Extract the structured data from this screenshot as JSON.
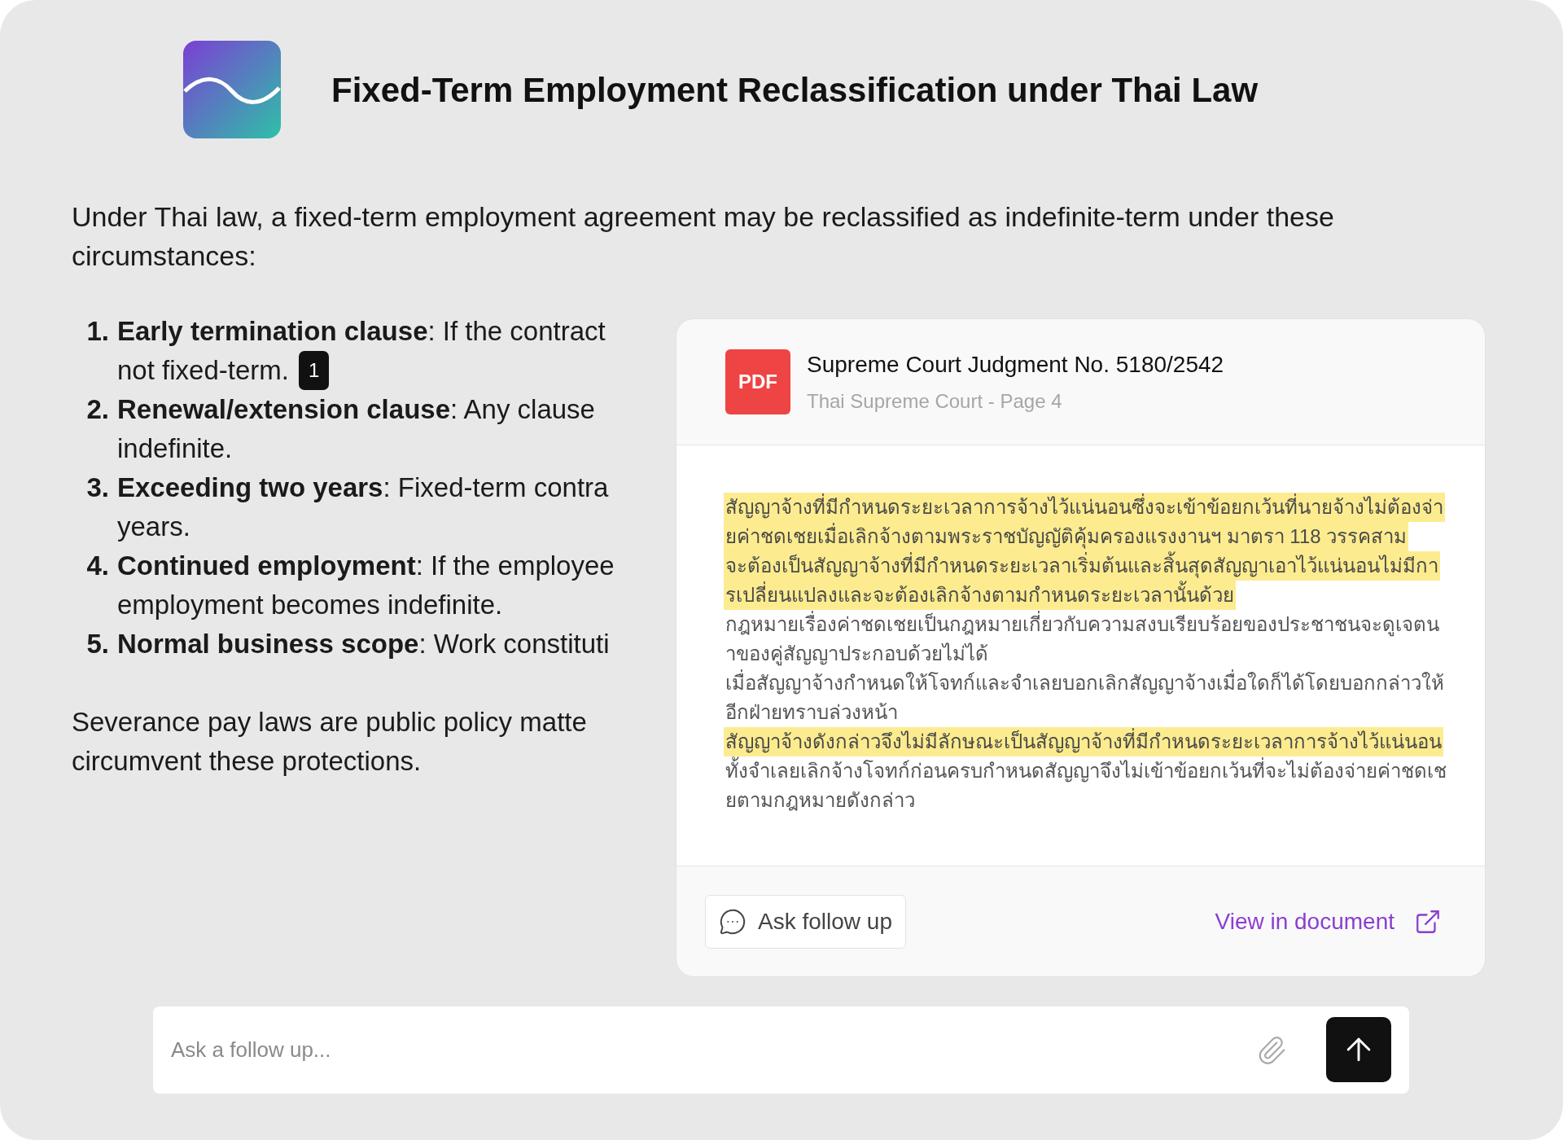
{
  "title": "Fixed-Term Employment Reclassification under Thai Law",
  "intro": "Under Thai law, a fixed-term employment agreement may be reclassified as indefinite-term under these circumstances:",
  "list": [
    {
      "number": "1.",
      "term": "Early termination clause",
      "rest": ": If the contract",
      "line2": "not fixed-term.",
      "citation": "1"
    },
    {
      "number": "2.",
      "term": "Renewal/extension clause",
      "rest": ": Any clause",
      "line2": "indefinite."
    },
    {
      "number": "3.",
      "term": "Exceeding two years",
      "rest": ": Fixed-term contra",
      "line2": "years."
    },
    {
      "number": "4.",
      "term": "Continued employment",
      "rest": ": If the employee",
      "line2": "employment becomes indefinite."
    },
    {
      "number": "5.",
      "term": "Normal business scope",
      "rest": ": Work constituti"
    }
  ],
  "closing": [
    "Severance pay laws are public policy matte",
    "circumvent these protections."
  ],
  "source_card": {
    "badge": "PDF",
    "title": "Supreme Court Judgment No. 5180/2542",
    "subtitle": "Thai Supreme Court - Page 4",
    "lines": [
      {
        "text": "สัญญาจ้างที่มีกำหนดระยะเวลาการจ้างไว้แน่นอนซึ่งจะเข้าข้อยกเว้นที่นายจ้างไม่ต้องจ่า",
        "highlighted": true
      },
      {
        "text": "ยค่าชดเชยเมื่อเลิกจ้างตามพระราชบัญญัติคุ้มครองแรงงานฯ มาตรา 118 วรรคสาม",
        "highlighted": true
      },
      {
        "text": "จะต้องเป็นสัญญาจ้างที่มีกำหนดระยะเวลาเริ่มต้นและสิ้นสุดสัญญาเอาไว้แน่นอนไม่มีกา",
        "highlighted": true
      },
      {
        "text": "รเปลี่ยนแปลงและจะต้องเลิกจ้างตามกำหนดระยะเวลานั้นด้วย",
        "highlighted": true
      },
      {
        "text": "กฎหมายเรื่องค่าชดเชยเป็นกฎหมายเกี่ยวกับความสงบเรียบร้อยของประชาชนจะดูเจตน",
        "highlighted": false
      },
      {
        "text": "าของคู่สัญญาประกอบด้วยไม่ได้",
        "highlighted": false
      },
      {
        "text": "เมื่อสัญญาจ้างกำหนดให้โจทก์และจำเลยบอกเลิกสัญญาจ้างเมื่อใดก็ได้โดยบอกกล่าวให้",
        "highlighted": false
      },
      {
        "text": "อีกฝ่ายทราบล่วงหน้า",
        "highlighted": false
      },
      {
        "text": "สัญญาจ้างดังกล่าวจึงไม่มีลักษณะเป็นสัญญาจ้างที่มีกำหนดระยะเวลาการจ้างไว้แน่นอน",
        "highlighted": true
      },
      {
        "text": "ทั้งจำเลยเลิกจ้างโจทก์ก่อนครบกำหนดสัญญาจึงไม่เข้าข้อยกเว้นที่จะไม่ต้องจ่ายค่าชดเช",
        "highlighted": false
      },
      {
        "text": "ยตามกฎหมายดังกล่าว",
        "highlighted": false
      }
    ],
    "ask_button": "Ask follow up",
    "view_link": "View in document"
  },
  "composer": {
    "placeholder": "Ask a follow up..."
  }
}
